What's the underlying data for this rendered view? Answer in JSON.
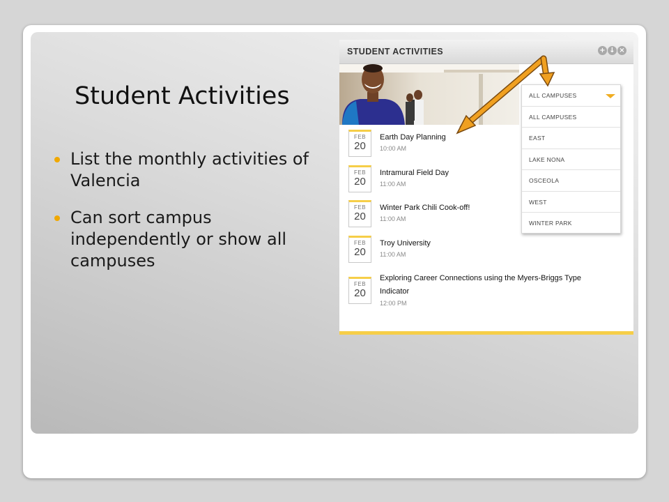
{
  "slide": {
    "title": "Student Activities",
    "bullets": [
      "List the monthly activities of Valencia",
      "Can sort campus independently or show all campuses"
    ]
  },
  "widget": {
    "header_title": "STUDENT ACTIVITIES",
    "controls": [
      "plus-icon",
      "download-icon",
      "close-icon"
    ],
    "events": [
      {
        "month": "FEB",
        "day": "20",
        "title": "Earth Day Planning",
        "time": "10:00 AM"
      },
      {
        "month": "FEB",
        "day": "20",
        "title": "Intramural Field Day",
        "time": "11:00 AM"
      },
      {
        "month": "FEB",
        "day": "20",
        "title": "Winter Park Chili Cook-off!",
        "time": "11:00 AM"
      },
      {
        "month": "FEB",
        "day": "20",
        "title": "Troy University",
        "time": "11:00 AM"
      },
      {
        "month": "FEB",
        "day": "20",
        "title": "Exploring Career Connections using the Myers-Briggs Type Indicator",
        "time": "12:00 PM"
      }
    ]
  },
  "campus_dropdown": {
    "selected": "ALL CAMPUSES",
    "options": [
      "ALL CAMPUSES",
      "EAST",
      "LAKE NONA",
      "OSCEOLA",
      "WEST",
      "WINTER PARK"
    ]
  },
  "colors": {
    "accent": "#f0a800",
    "widget_border": "#f6ce48",
    "arrow": "#f0a020"
  }
}
